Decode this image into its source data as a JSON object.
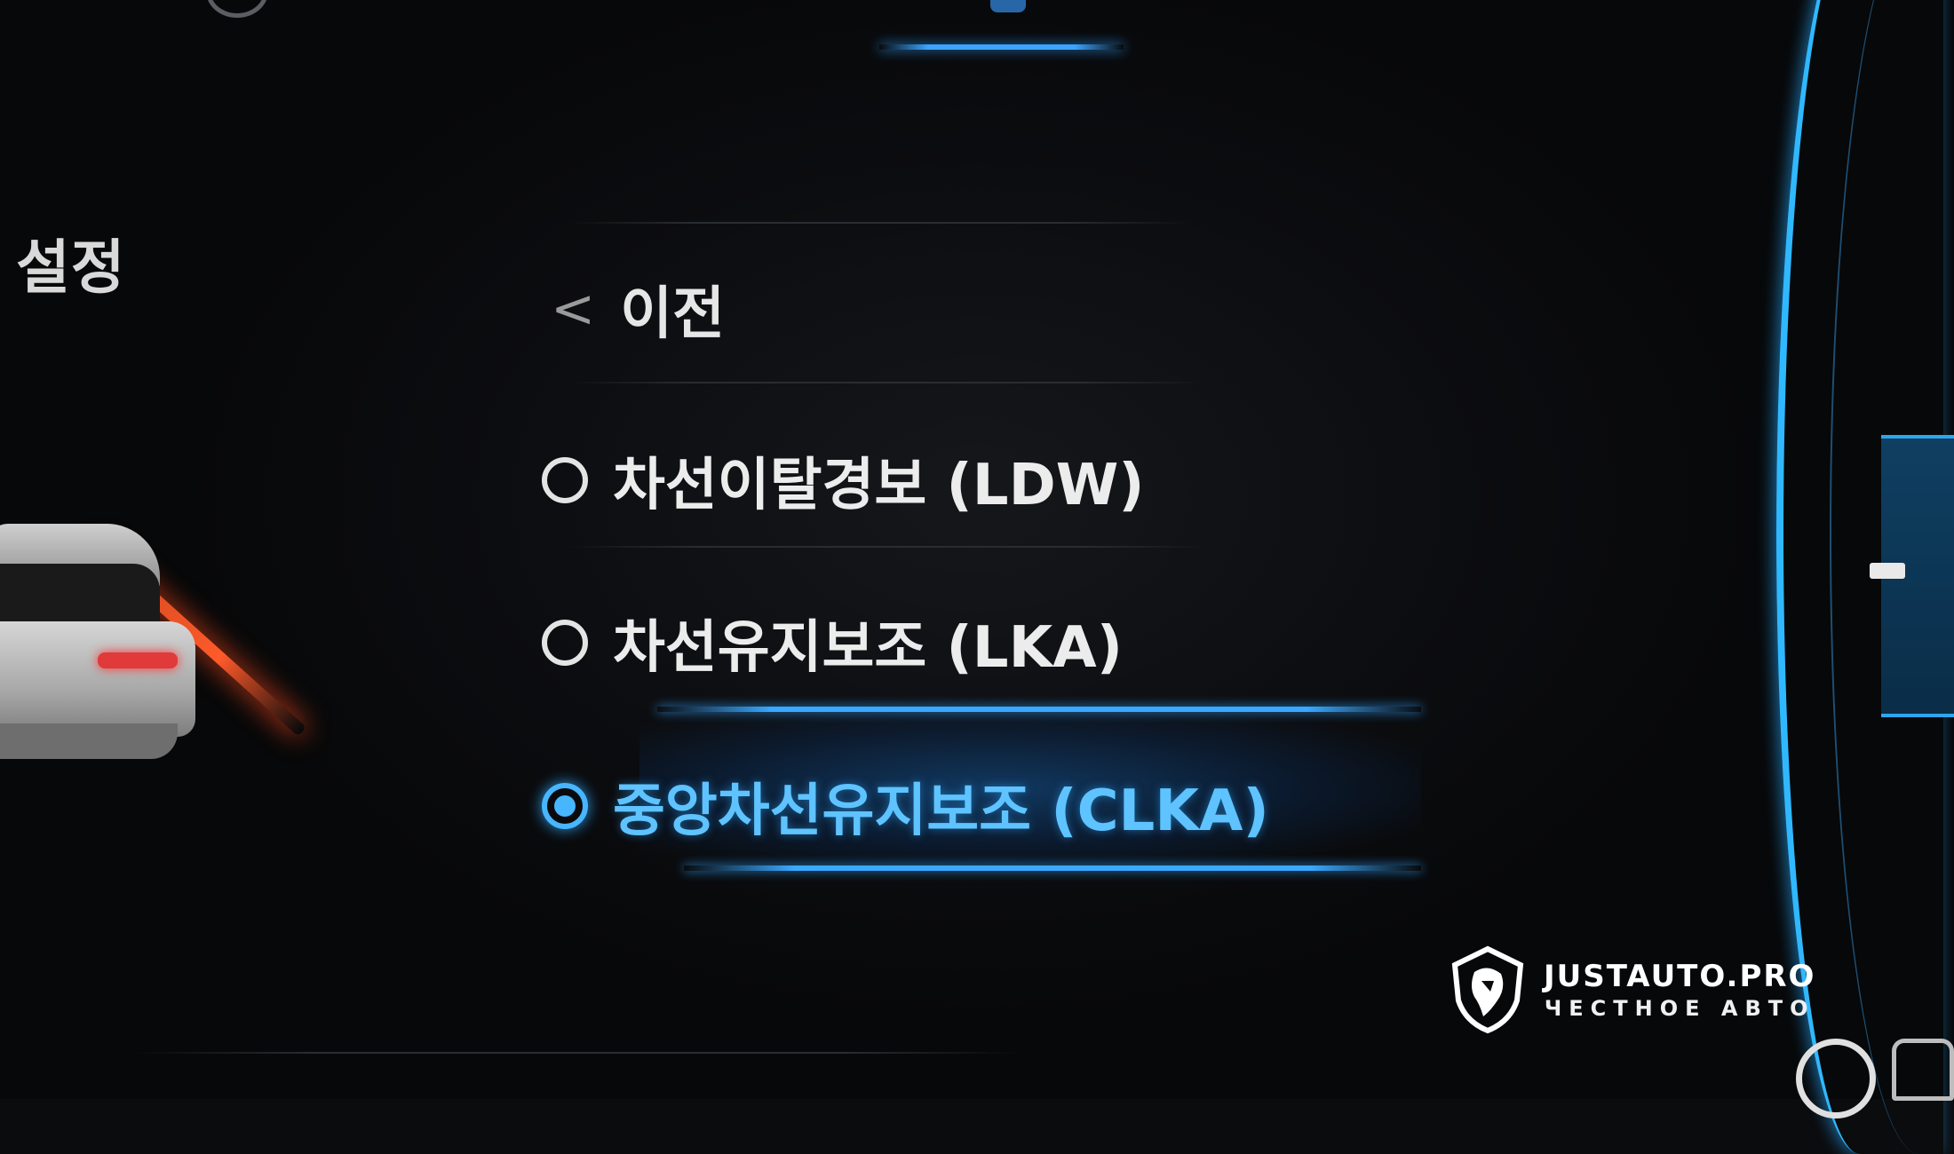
{
  "header": {
    "section_title": "설정"
  },
  "menu": {
    "back": {
      "chevron": "<",
      "label": "이전"
    },
    "options": [
      {
        "label": "차선이탈경보 (LDW)",
        "selected": false
      },
      {
        "label": "차선유지보조 (LKA)",
        "selected": false
      },
      {
        "label": "중앙차선유지보조 (CLKA)",
        "selected": true
      }
    ]
  },
  "watermark": {
    "brand": "JUSTAUTO.PRO",
    "tagline": "ЧЕСТНОЕ АВТО"
  },
  "colors": {
    "accent": "#3aa8ff",
    "selected_text": "#5ec3ff",
    "lane_warning": "#ff5a2a",
    "background": "#0b0c0e"
  }
}
